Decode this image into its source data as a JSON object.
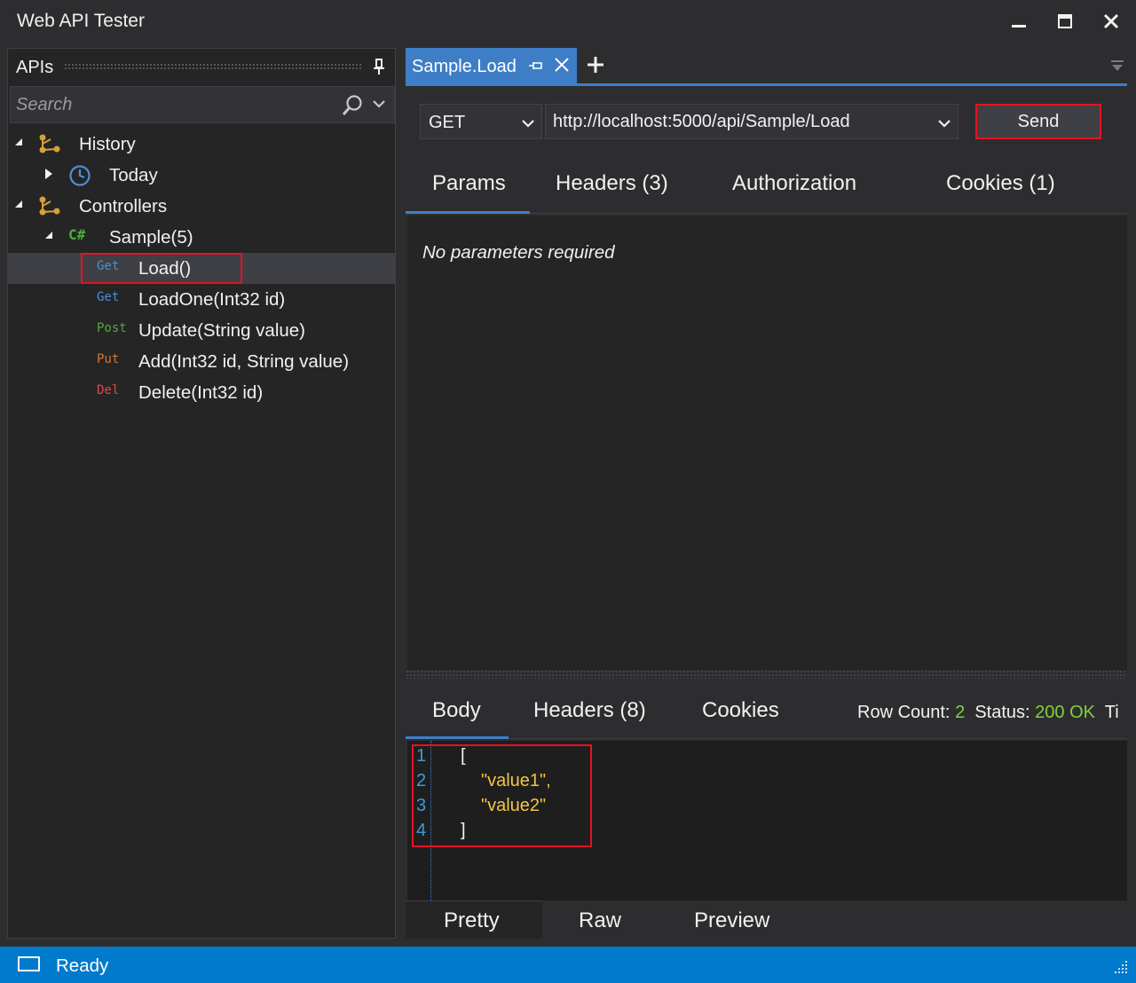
{
  "window": {
    "title": "Web API Tester",
    "controls": [
      "minimize",
      "maximize",
      "close"
    ]
  },
  "apis_panel": {
    "title": "APIs",
    "search": {
      "placeholder": "Search",
      "value": ""
    },
    "tree": {
      "history": {
        "label": "History",
        "expanded": true,
        "children": [
          {
            "label": "Today",
            "expanded": false
          }
        ]
      },
      "controllers": {
        "label": "Controllers",
        "expanded": true,
        "controller": {
          "label": "Sample(5)",
          "icon_text": "C#",
          "methods": [
            {
              "verb": "Get",
              "label": "Load()",
              "selected": true
            },
            {
              "verb": "Get",
              "label": "LoadOne(Int32 id)"
            },
            {
              "verb": "Post",
              "label": "Update(String value)"
            },
            {
              "verb": "Put",
              "label": "Add(Int32 id, String value)"
            },
            {
              "verb": "Del",
              "label": "Delete(Int32 id)"
            }
          ]
        }
      }
    }
  },
  "doc_tab": {
    "label": "Sample.Load",
    "add_label": "+"
  },
  "request": {
    "method": "GET",
    "url": "http://localhost:5000/api/Sample/Load",
    "send_label": "Send",
    "tabs": [
      "Params",
      "Headers (3)",
      "Authorization",
      "Cookies (1)"
    ],
    "active_tab": "Params",
    "params_message": "No parameters required"
  },
  "response": {
    "tabs": [
      "Body",
      "Headers (8)",
      "Cookies"
    ],
    "active_tab": "Body",
    "row_count_label": "Row Count:",
    "row_count": "2",
    "status_label": "Status:",
    "status_value": "200 OK",
    "truncated_label": "Ti",
    "body_lines": [
      {
        "n": "1",
        "text": "["
      },
      {
        "n": "2",
        "text": "\"value1\","
      },
      {
        "n": "3",
        "text": "\"value2\""
      },
      {
        "n": "4",
        "text": "]"
      }
    ],
    "view_tabs": [
      "Pretty",
      "Raw",
      "Preview"
    ],
    "active_view": "Pretty"
  },
  "statusbar": {
    "text": "Ready"
  },
  "colors": {
    "accent": "#3e7ec7",
    "statusbar": "#007acc",
    "highlight_border": "#e81123",
    "verb_get": "#4a8fd9",
    "verb_post": "#4cae3a",
    "verb_put": "#d9762b",
    "verb_del": "#e04a4a",
    "status_ok": "#7fd23d",
    "json_string": "#f4c542"
  }
}
